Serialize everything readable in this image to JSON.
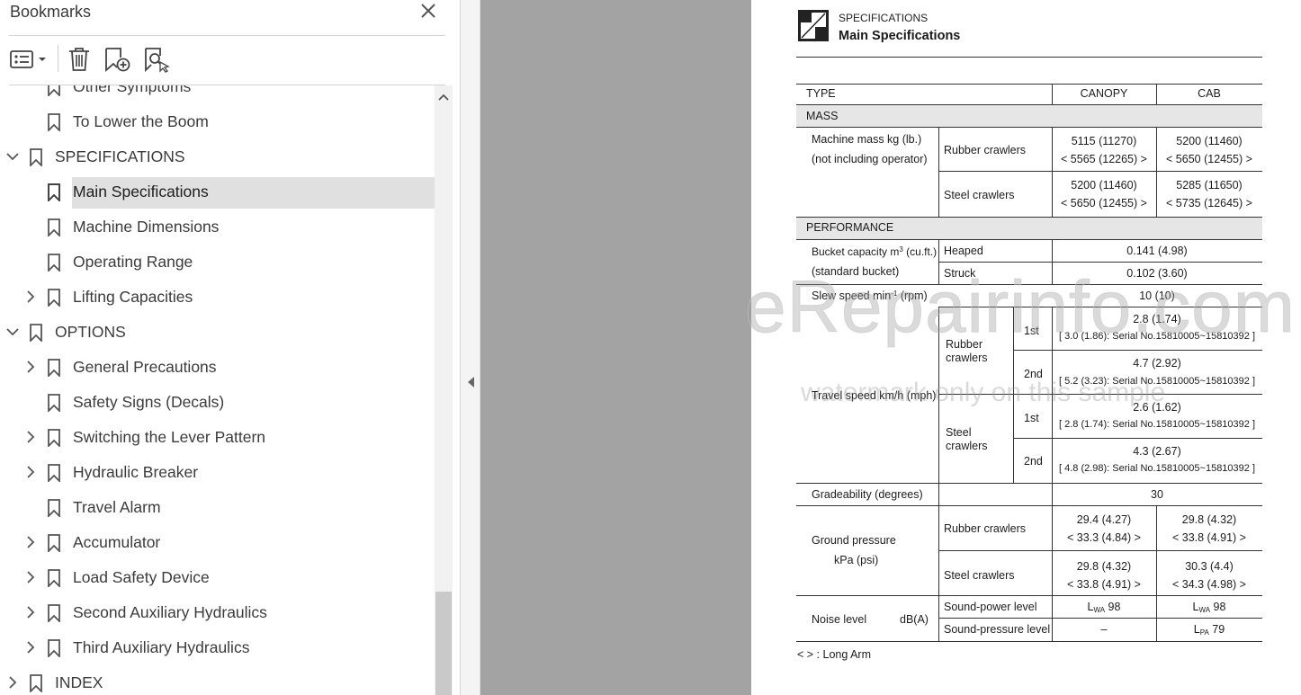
{
  "panel": {
    "title": "Bookmarks",
    "items": [
      {
        "label": "Other Symptoms",
        "level": 2,
        "expandable": false,
        "expanded": false
      },
      {
        "label": "To Lower the Boom",
        "level": 2,
        "expandable": false,
        "expanded": false
      },
      {
        "label": "SPECIFICATIONS",
        "level": 1,
        "expandable": true,
        "expanded": true
      },
      {
        "label": "Main Specifications",
        "level": 2,
        "expandable": false,
        "expanded": false,
        "selected": true
      },
      {
        "label": "Machine Dimensions",
        "level": 2,
        "expandable": false,
        "expanded": false
      },
      {
        "label": "Operating Range",
        "level": 2,
        "expandable": false,
        "expanded": false
      },
      {
        "label": "Lifting Capacities",
        "level": 2,
        "expandable": true,
        "expanded": false
      },
      {
        "label": "OPTIONS",
        "level": 1,
        "expandable": true,
        "expanded": true
      },
      {
        "label": "General Precautions",
        "level": 2,
        "expandable": true,
        "expanded": false
      },
      {
        "label": "Safety Signs (Decals)",
        "level": 2,
        "expandable": false,
        "expanded": false
      },
      {
        "label": "Switching the Lever Pattern",
        "level": 2,
        "expandable": true,
        "expanded": false
      },
      {
        "label": "Hydraulic Breaker",
        "level": 2,
        "expandable": true,
        "expanded": false
      },
      {
        "label": "Travel Alarm",
        "level": 2,
        "expandable": false,
        "expanded": false
      },
      {
        "label": "Accumulator",
        "level": 2,
        "expandable": true,
        "expanded": false
      },
      {
        "label": "Load Safety Device",
        "level": 2,
        "expandable": true,
        "expanded": false
      },
      {
        "label": "Second Auxiliary Hydraulics",
        "level": 2,
        "expandable": true,
        "expanded": false
      },
      {
        "label": "Third Auxiliary Hydraulics",
        "level": 2,
        "expandable": true,
        "expanded": false
      },
      {
        "label": "INDEX",
        "level": 1,
        "expandable": true,
        "expanded": false
      }
    ]
  },
  "doc": {
    "section": "SPECIFICATIONS",
    "title": "Main Specifications",
    "header": {
      "type": "TYPE",
      "canopy": "CANOPY",
      "cab": "CAB"
    },
    "mass": {
      "heading": "MASS",
      "label1": "Machine mass  kg (lb.)",
      "label2": "(not including operator)",
      "rubber": "Rubber crawlers",
      "steel": "Steel crawlers",
      "rubber_canopy": [
        "5115 (11270)",
        "< 5565 (12265) >"
      ],
      "rubber_cab": [
        "5200 (11460)",
        "< 5650 (12455) >"
      ],
      "steel_canopy": [
        "5200 (11460)",
        "< 5650 (12455) >"
      ],
      "steel_cab": [
        "5285 (11650)",
        "< 5735 (12645) >"
      ]
    },
    "performance": {
      "heading": "PERFORMANCE",
      "bucket_label1": "Bucket capacity m",
      "bucket_label1_sup": "3",
      "bucket_label1_unit": " (cu.ft.)",
      "bucket_label2": "(standard bucket)",
      "heaped": "Heaped",
      "heaped_val": "0.141 (4.98)",
      "struck": "Struck",
      "struck_val": "0.102 (3.60)",
      "slew_label": "Slew speed  min",
      "slew_sup": "-1",
      "slew_unit": " (rpm)",
      "slew_val": "10 (10)",
      "travel_label": "Travel speed km/h (mph)",
      "rubber": "Rubber crawlers",
      "steel": "Steel crawlers",
      "first": "1st",
      "second": "2nd",
      "rubber_1st": [
        "2.8 (1.74)",
        "[ 3.0 (1.86): Serial No.15810005~15810392 ]"
      ],
      "rubber_2nd": [
        "4.7 (2.92)",
        "[ 5.2 (3.23): Serial No.15810005~15810392 ]"
      ],
      "steel_1st": [
        "2.6 (1.62)",
        "[ 2.8 (1.74): Serial No.15810005~15810392 ]"
      ],
      "steel_2nd": [
        "4.3 (2.67)",
        "[ 4.8 (2.98): Serial No.15810005~15810392 ]"
      ],
      "grade_label": "Gradeability (degrees)",
      "grade_val": "30",
      "ground_label1": "Ground pressure",
      "ground_label2": "kPa (psi)",
      "ground_rubber_canopy": [
        "29.4 (4.27)",
        "< 33.3 (4.84) >"
      ],
      "ground_rubber_cab": [
        "29.8 (4.32)",
        "< 33.8 (4.91) >"
      ],
      "ground_steel_canopy": [
        "29.8 (4.32)",
        "< 33.8 (4.91) >"
      ],
      "ground_steel_cab": [
        "30.3 (4.4)",
        "< 34.3 (4.98) >"
      ],
      "noise_label": "Noise level",
      "noise_unit": "dB(A)",
      "sound_power": "Sound-power level",
      "sound_pressure": "Sound-pressure level",
      "lwa_canopy_prefix": "L",
      "lwa_sub": "WA",
      "lwa_canopy_val": " 98",
      "lwa_cab_val": " 98",
      "lpa_canopy": "–",
      "lpa_sub": "PA",
      "lpa_cab_val": " 79"
    },
    "footnote": "<  > :  Long Arm"
  },
  "watermark": {
    "main": "eRepairinfo.com",
    "sub": "watermark only on this sample"
  }
}
